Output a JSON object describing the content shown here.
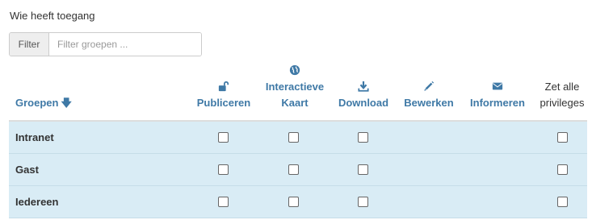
{
  "section_title": "Wie heeft toegang",
  "filter": {
    "addon_label": "Filter",
    "placeholder": "Filter groepen ..."
  },
  "columns": {
    "groups": "Groepen",
    "publish": {
      "label": "Publiceren",
      "icon": "unlock-icon"
    },
    "interactive_map": {
      "label_line1": "Interactieve",
      "label_line2": "Kaart",
      "icon": "globe-icon"
    },
    "download": {
      "label": "Download",
      "icon": "download-icon"
    },
    "edit": {
      "label": "Bewerken",
      "icon": "pencil-icon"
    },
    "notify": {
      "label": "Informeren",
      "icon": "envelope-icon"
    },
    "set_all": {
      "label_line1": "Zet alle",
      "label_line2": "privileges"
    }
  },
  "rows": [
    {
      "name": "Intranet",
      "publish": false,
      "interactive_map": false,
      "download": false,
      "set_all": false
    },
    {
      "name": "Gast",
      "publish": false,
      "interactive_map": false,
      "download": false,
      "set_all": false
    },
    {
      "name": "Iedereen",
      "publish": false,
      "interactive_map": false,
      "download": false,
      "set_all": false
    }
  ],
  "colors": {
    "link": "#3f79a6",
    "row_background": "#d9ecf5",
    "text": "#333333"
  }
}
